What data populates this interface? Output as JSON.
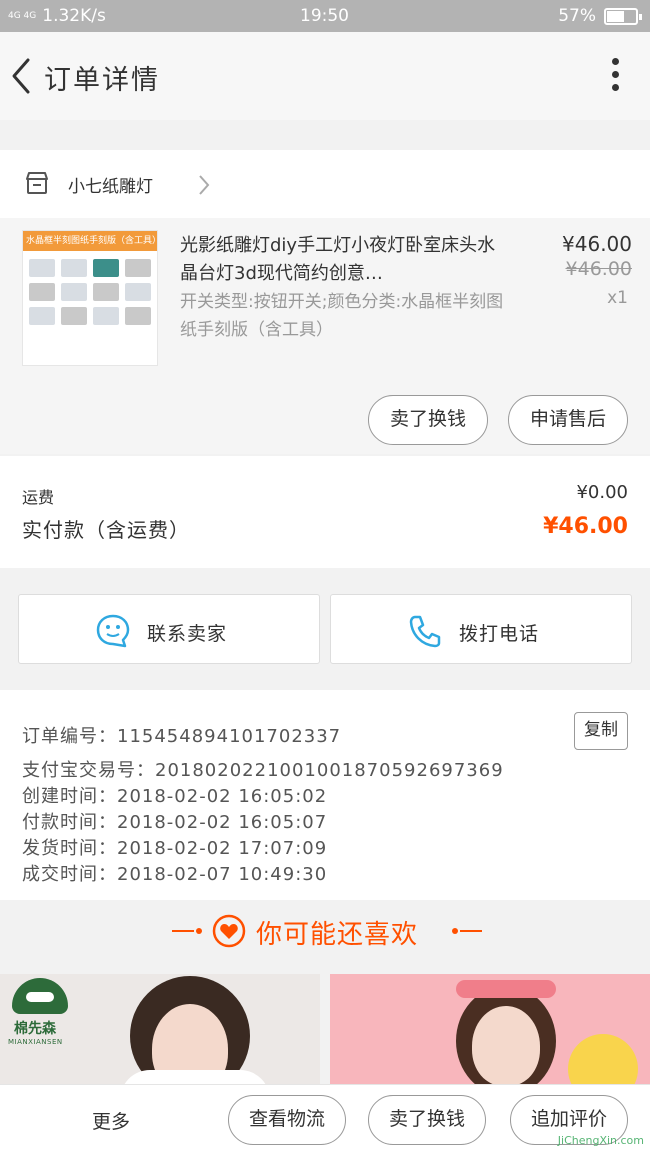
{
  "status_bar": {
    "network": "4G 4G",
    "speed": "1.32K/s",
    "time": "19:50",
    "battery": "57%",
    "battery_level": 0.57
  },
  "header": {
    "title": "订单详情"
  },
  "shop": {
    "name": "小七纸雕灯"
  },
  "product": {
    "thumb_banner": "水晶框半刻图纸手刻版（含工具）",
    "title": "光影纸雕灯diy手工灯小夜灯卧室床头水晶台灯3d现代简约创意…",
    "sku": "开关类型:按钮开关;颜色分类:水晶框半刻图纸手刻版（含工具）",
    "price": "¥46.00",
    "original_price": "¥46.00",
    "quantity": "x1",
    "sell_label": "卖了换钱",
    "refund_label": "申请售后"
  },
  "totals": {
    "shipping_label": "运费",
    "shipping_value": "¥0.00",
    "paid_label": "实付款（含运费）",
    "paid_value": "¥46.00"
  },
  "contact": {
    "seller_label": "联系卖家",
    "phone_label": "拨打电话"
  },
  "order_info": {
    "order_no": "订单编号：115454894101702337",
    "copy_label": "复制",
    "alipay_no": "支付宝交易号：2018020221001001870592697369",
    "created": "创建时间：2018-02-02  16:05:02",
    "paid": "付款时间：2018-02-02  16:05:07",
    "shipped": "发货时间：2018-02-02  17:07:09",
    "completed": "成交时间：2018-02-07  10:49:30"
  },
  "recommend": {
    "title": "你可能还喜欢",
    "brand_cn": "棉先森",
    "brand_en": "MIANXIANSEN"
  },
  "bottom_bar": {
    "more": "更多",
    "logistics": "查看物流",
    "sell": "卖了换钱",
    "review": "追加评价"
  },
  "watermark": "JiChengXin.com",
  "colors": {
    "accent": "#ff5000",
    "status_bar": "#b3b3b3",
    "contact_icon": "#2fa8e0",
    "logo_green": "#2d6b3a"
  }
}
